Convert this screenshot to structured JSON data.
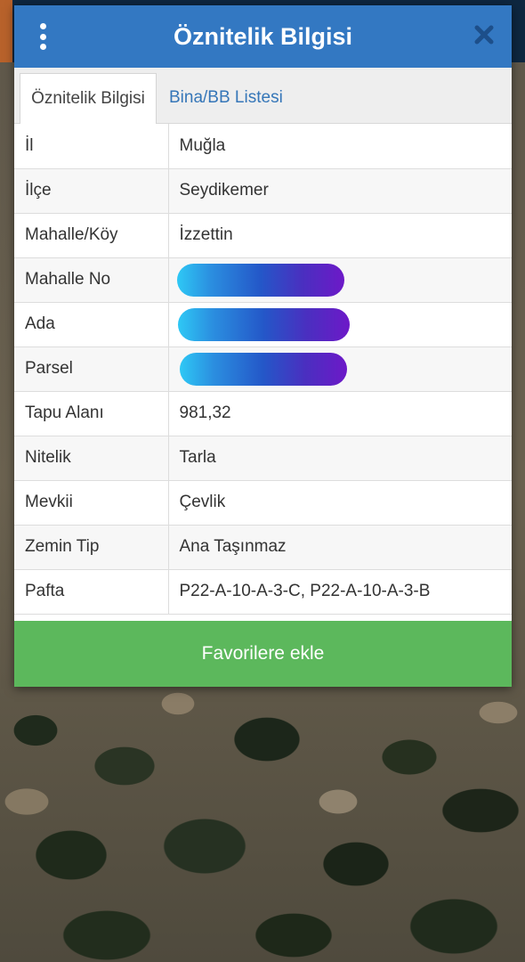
{
  "dialog": {
    "title": "Öznitelik Bilgisi",
    "menu_icon": "vertical-dots-icon",
    "close_icon": "close-icon"
  },
  "tabs": [
    {
      "label": "Öznitelik Bilgisi",
      "active": true
    },
    {
      "label": "Bina/BB Listesi",
      "active": false
    }
  ],
  "rows": [
    {
      "key": "İl",
      "value": "Muğla"
    },
    {
      "key": "İlçe",
      "value": "Seydikemer"
    },
    {
      "key": "Mahalle/Köy",
      "value": "İzzettin"
    },
    {
      "key": "Mahalle No",
      "value": "",
      "redacted": true
    },
    {
      "key": "Ada",
      "value": "",
      "redacted": true
    },
    {
      "key": "Parsel",
      "value": "",
      "redacted": true
    },
    {
      "key": "Tapu Alanı",
      "value": "981,32"
    },
    {
      "key": "Nitelik",
      "value": "Tarla"
    },
    {
      "key": "Mevkii",
      "value": "Çevlik"
    },
    {
      "key": "Zemin Tip",
      "value": "Ana Taşınmaz"
    },
    {
      "key": "Pafta",
      "value": "P22-A-10-A-3-C, P22-A-10-A-3-B"
    }
  ],
  "favorite_button": "Favorilere ekle",
  "colors": {
    "header": "#3378c2",
    "tab_link": "#3576b8",
    "favorite": "#5cb85c",
    "redaction_start": "#2ec8f5",
    "redaction_end": "#6d19c8"
  }
}
